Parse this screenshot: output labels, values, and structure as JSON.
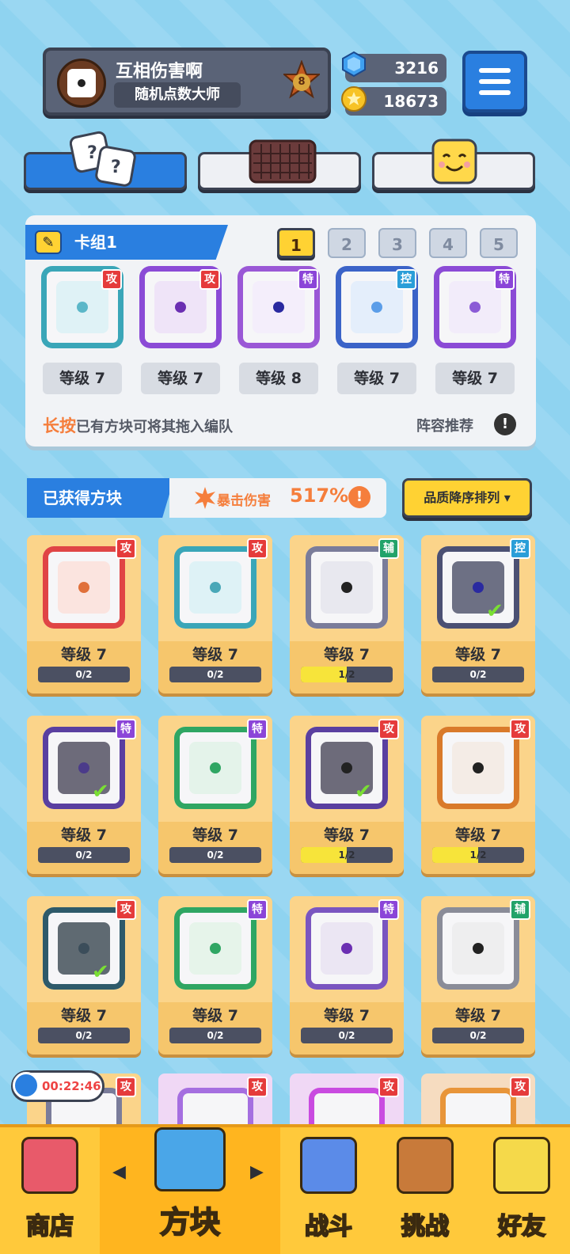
{
  "player": {
    "name": "互相伤害啊",
    "title": "随机点数大师",
    "rank": "8"
  },
  "currency": {
    "gems": "3216",
    "coins": "18673"
  },
  "deck": {
    "title": "卡组1",
    "numbers": [
      "1",
      "2",
      "3",
      "4",
      "5"
    ],
    "active_index": 0,
    "dice": [
      {
        "tag": "攻",
        "level": "等级 7",
        "frame": "#3aa6b8",
        "bg": "#dff2f6",
        "dot": "#5bb7c8",
        "tag_color": "#e53b3b"
      },
      {
        "tag": "攻",
        "level": "等级 7",
        "frame": "#8b4bd6",
        "bg": "#efe4f8",
        "dot": "#6b2fb2",
        "tag_color": "#e53b3b"
      },
      {
        "tag": "特",
        "level": "等级 8",
        "frame": "#9a58d6",
        "bg": "#f4eefb",
        "dot": "#2a2aa0",
        "tag_color": "#8b45d8"
      },
      {
        "tag": "控",
        "level": "等级 7",
        "frame": "#3b63c8",
        "bg": "#e4eefb",
        "dot": "#5b9de8",
        "tag_color": "#2a9ed8"
      },
      {
        "tag": "特",
        "level": "等级 7",
        "frame": "#8b4bd6",
        "bg": "#f2ecfa",
        "dot": "#8b5bd6",
        "tag_color": "#8b45d8"
      }
    ],
    "hint_highlight": "长按",
    "hint_text": "已有方块可将其拖入编队",
    "recommend": "阵容推荐"
  },
  "owned": {
    "title": "已获得方块",
    "crit_label": "暴击伤害",
    "crit_value": "517%",
    "sort_label": "品质降序排列 ▾",
    "cards": [
      {
        "tag": "攻",
        "level": "等级 7",
        "progress": "0/2",
        "fill": 0,
        "check": false,
        "frame": "#e04545",
        "bg": "#fbe4df",
        "dot": "#e0703a",
        "tag_color": "#e53b3b"
      },
      {
        "tag": "攻",
        "level": "等级 7",
        "progress": "0/2",
        "fill": 0,
        "check": false,
        "frame": "#3aa6b8",
        "bg": "#def2f6",
        "dot": "#49a8b8",
        "tag_color": "#e53b3b"
      },
      {
        "tag": "辅",
        "level": "等级 7",
        "progress": "1/2",
        "fill": 0.5,
        "check": false,
        "frame": "#7a7c9a",
        "bg": "#e8e8ef",
        "dot": "#222222",
        "tag_color": "#22a36a"
      },
      {
        "tag": "控",
        "level": "等级 7",
        "progress": "0/2",
        "fill": 0,
        "check": true,
        "frame": "#4b5073",
        "bg": "#6d7084",
        "dot": "#2a2aa0",
        "tag_color": "#2a9ed8"
      },
      {
        "tag": "特",
        "level": "等级 7",
        "progress": "0/2",
        "fill": 0,
        "check": true,
        "frame": "#5a3fa0",
        "bg": "#6d6b7a",
        "dot": "#4b3b8a",
        "tag_color": "#8b45d8"
      },
      {
        "tag": "特",
        "level": "等级 7",
        "progress": "0/2",
        "fill": 0,
        "check": false,
        "frame": "#2fa663",
        "bg": "#e4f3ea",
        "dot": "#2fa663",
        "tag_color": "#8b45d8"
      },
      {
        "tag": "攻",
        "level": "等级 7",
        "progress": "1/2",
        "fill": 0.5,
        "check": true,
        "frame": "#5a3fa0",
        "bg": "#6d6b7a",
        "dot": "#222222",
        "tag_color": "#e53b3b"
      },
      {
        "tag": "攻",
        "level": "等级 7",
        "progress": "1/2",
        "fill": 0.5,
        "check": false,
        "frame": "#d97a2a",
        "bg": "#f4ece6",
        "dot": "#222222",
        "tag_color": "#e53b3b"
      },
      {
        "tag": "攻",
        "level": "等级 7",
        "progress": "0/2",
        "fill": 0,
        "check": true,
        "frame": "#2e5a6a",
        "bg": "#5f6a72",
        "dot": "#3b4d5a",
        "tag_color": "#e53b3b"
      },
      {
        "tag": "特",
        "level": "等级 7",
        "progress": "0/2",
        "fill": 0,
        "check": false,
        "frame": "#2fa663",
        "bg": "#e6f4ea",
        "dot": "#2fa663",
        "tag_color": "#8b45d8"
      },
      {
        "tag": "特",
        "level": "等级 7",
        "progress": "0/2",
        "fill": 0,
        "check": false,
        "frame": "#7a55c0",
        "bg": "#ebe6f3",
        "dot": "#6b2fb2",
        "tag_color": "#8b45d8"
      },
      {
        "tag": "辅",
        "level": "等级 7",
        "progress": "0/2",
        "fill": 0,
        "check": false,
        "frame": "#8a8c98",
        "bg": "#eeeeef",
        "dot": "#222222",
        "tag_color": "#22a36a"
      }
    ],
    "partial_tags": [
      "攻",
      "攻",
      "攻",
      "攻"
    ]
  },
  "timer": "00:22:46",
  "nav": {
    "items": [
      {
        "label": "商店",
        "icon": "shop-icon",
        "color": "#e85a6a"
      },
      {
        "label": "方块",
        "icon": "dice-box-icon",
        "color": "#4aa6e8"
      },
      {
        "label": "战斗",
        "icon": "sword-shield-icon",
        "color": "#5b8be8"
      },
      {
        "label": "挑战",
        "icon": "challenge-sign-icon",
        "color": "#c87a3a"
      },
      {
        "label": "好友",
        "icon": "friend-cube-icon",
        "color": "#f5d94a"
      }
    ],
    "active_index": 1,
    "left_arrow": "◀",
    "right_arrow": "▶"
  }
}
